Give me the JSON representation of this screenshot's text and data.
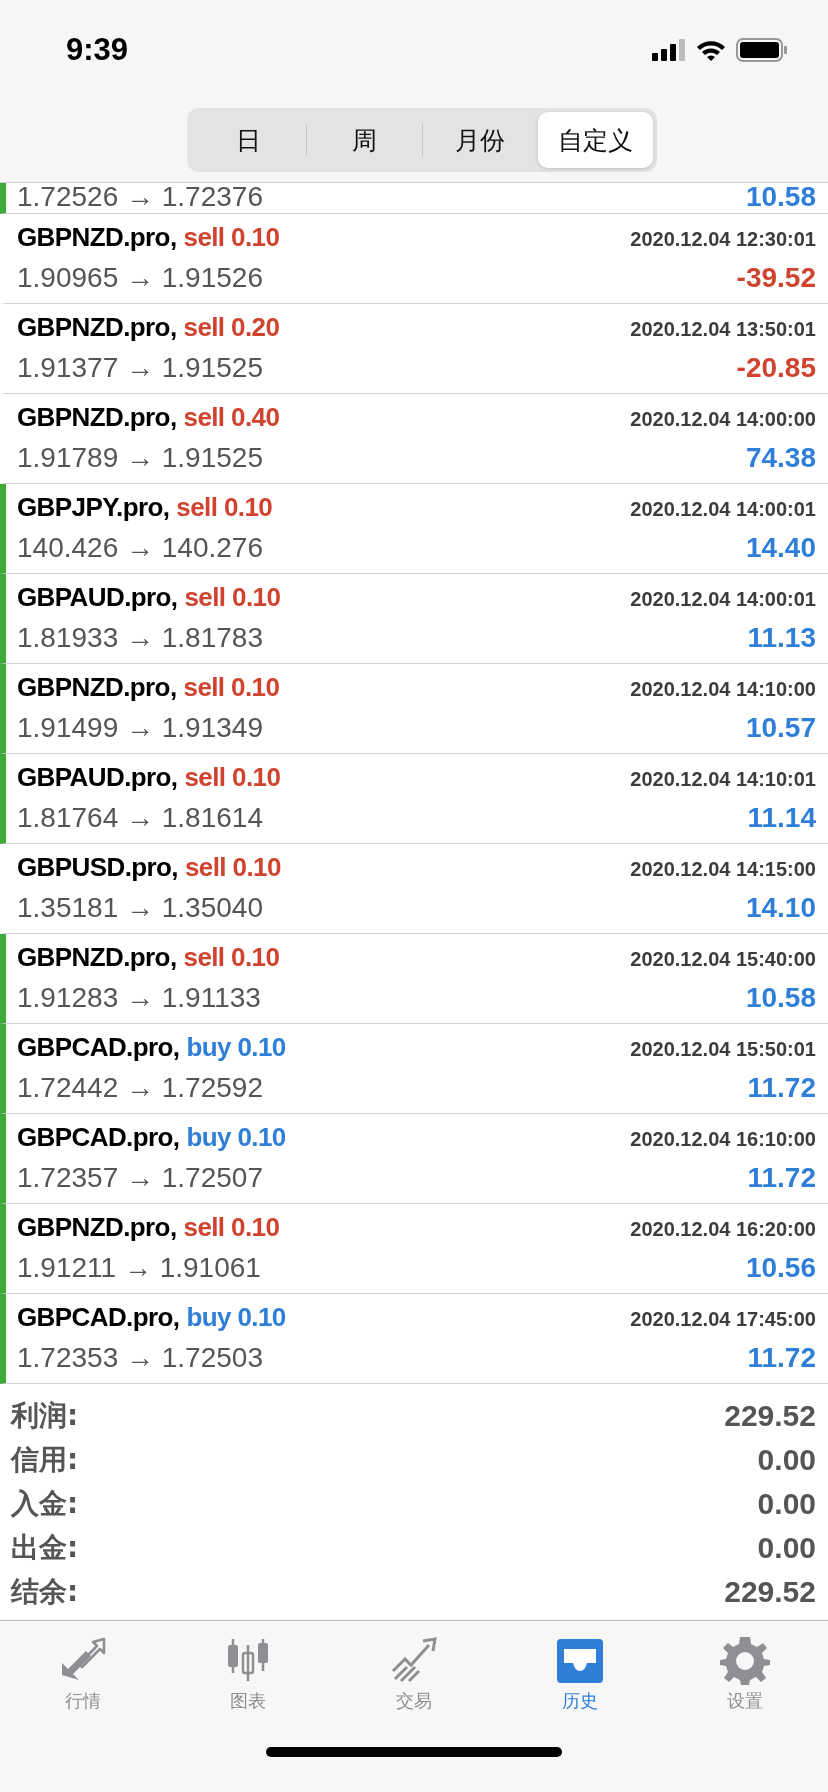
{
  "status_bar": {
    "time": "9:39"
  },
  "segments": [
    {
      "label": "日",
      "selected": false
    },
    {
      "label": "周",
      "selected": false
    },
    {
      "label": "月份",
      "selected": false
    },
    {
      "label": "自定义",
      "selected": true
    }
  ],
  "partial_row": {
    "prices": "1.72526 → 1.72376",
    "profit": "10.58",
    "negative": false,
    "marked": true
  },
  "trades": [
    {
      "symbol": "GBPNZD.pro,",
      "order": "sell 0.10",
      "kind": "sell",
      "time": "2020.12.04 12:30:01",
      "prices": "1.90965 → 1.91526",
      "profit": "-39.52",
      "negative": true,
      "marked": false
    },
    {
      "symbol": "GBPNZD.pro,",
      "order": "sell 0.20",
      "kind": "sell",
      "time": "2020.12.04 13:50:01",
      "prices": "1.91377 → 1.91525",
      "profit": "-20.85",
      "negative": true,
      "marked": false
    },
    {
      "symbol": "GBPNZD.pro,",
      "order": "sell 0.40",
      "kind": "sell",
      "time": "2020.12.04 14:00:00",
      "prices": "1.91789 → 1.91525",
      "profit": "74.38",
      "negative": false,
      "marked": false
    },
    {
      "symbol": "GBPJPY.pro,",
      "order": "sell 0.10",
      "kind": "sell",
      "time": "2020.12.04 14:00:01",
      "prices": "140.426 → 140.276",
      "profit": "14.40",
      "negative": false,
      "marked": true
    },
    {
      "symbol": "GBPAUD.pro,",
      "order": "sell 0.10",
      "kind": "sell",
      "time": "2020.12.04 14:00:01",
      "prices": "1.81933 → 1.81783",
      "profit": "11.13",
      "negative": false,
      "marked": true
    },
    {
      "symbol": "GBPNZD.pro,",
      "order": "sell 0.10",
      "kind": "sell",
      "time": "2020.12.04 14:10:00",
      "prices": "1.91499 → 1.91349",
      "profit": "10.57",
      "negative": false,
      "marked": true
    },
    {
      "symbol": "GBPAUD.pro,",
      "order": "sell 0.10",
      "kind": "sell",
      "time": "2020.12.04 14:10:01",
      "prices": "1.81764 → 1.81614",
      "profit": "11.14",
      "negative": false,
      "marked": true
    },
    {
      "symbol": "GBPUSD.pro,",
      "order": "sell 0.10",
      "kind": "sell",
      "time": "2020.12.04 14:15:00",
      "prices": "1.35181 → 1.35040",
      "profit": "14.10",
      "negative": false,
      "marked": false
    },
    {
      "symbol": "GBPNZD.pro,",
      "order": "sell 0.10",
      "kind": "sell",
      "time": "2020.12.04 15:40:00",
      "prices": "1.91283 → 1.91133",
      "profit": "10.58",
      "negative": false,
      "marked": true
    },
    {
      "symbol": "GBPCAD.pro,",
      "order": "buy 0.10",
      "kind": "buy",
      "time": "2020.12.04 15:50:01",
      "prices": "1.72442 → 1.72592",
      "profit": "11.72",
      "negative": false,
      "marked": true
    },
    {
      "symbol": "GBPCAD.pro,",
      "order": "buy 0.10",
      "kind": "buy",
      "time": "2020.12.04 16:10:00",
      "prices": "1.72357 → 1.72507",
      "profit": "11.72",
      "negative": false,
      "marked": true
    },
    {
      "symbol": "GBPNZD.pro,",
      "order": "sell 0.10",
      "kind": "sell",
      "time": "2020.12.04 16:20:00",
      "prices": "1.91211 → 1.91061",
      "profit": "10.56",
      "negative": false,
      "marked": true
    },
    {
      "symbol": "GBPCAD.pro,",
      "order": "buy 0.10",
      "kind": "buy",
      "time": "2020.12.04 17:45:00",
      "prices": "1.72353 → 1.72503",
      "profit": "11.72",
      "negative": false,
      "marked": true
    }
  ],
  "summary": [
    {
      "label": "利润:",
      "value": "229.52"
    },
    {
      "label": "信用:",
      "value": "0.00"
    },
    {
      "label": "入金:",
      "value": "0.00"
    },
    {
      "label": "出金:",
      "value": "0.00"
    },
    {
      "label": "结余:",
      "value": "229.52"
    }
  ],
  "tab_bar": [
    {
      "label": "行情",
      "kind": "arrows",
      "selected": false
    },
    {
      "label": "图表",
      "kind": "candles",
      "selected": false
    },
    {
      "label": "交易",
      "kind": "trend",
      "selected": false
    },
    {
      "label": "历史",
      "kind": "inbox",
      "selected": true
    },
    {
      "label": "设置",
      "kind": "gear",
      "selected": false
    }
  ]
}
